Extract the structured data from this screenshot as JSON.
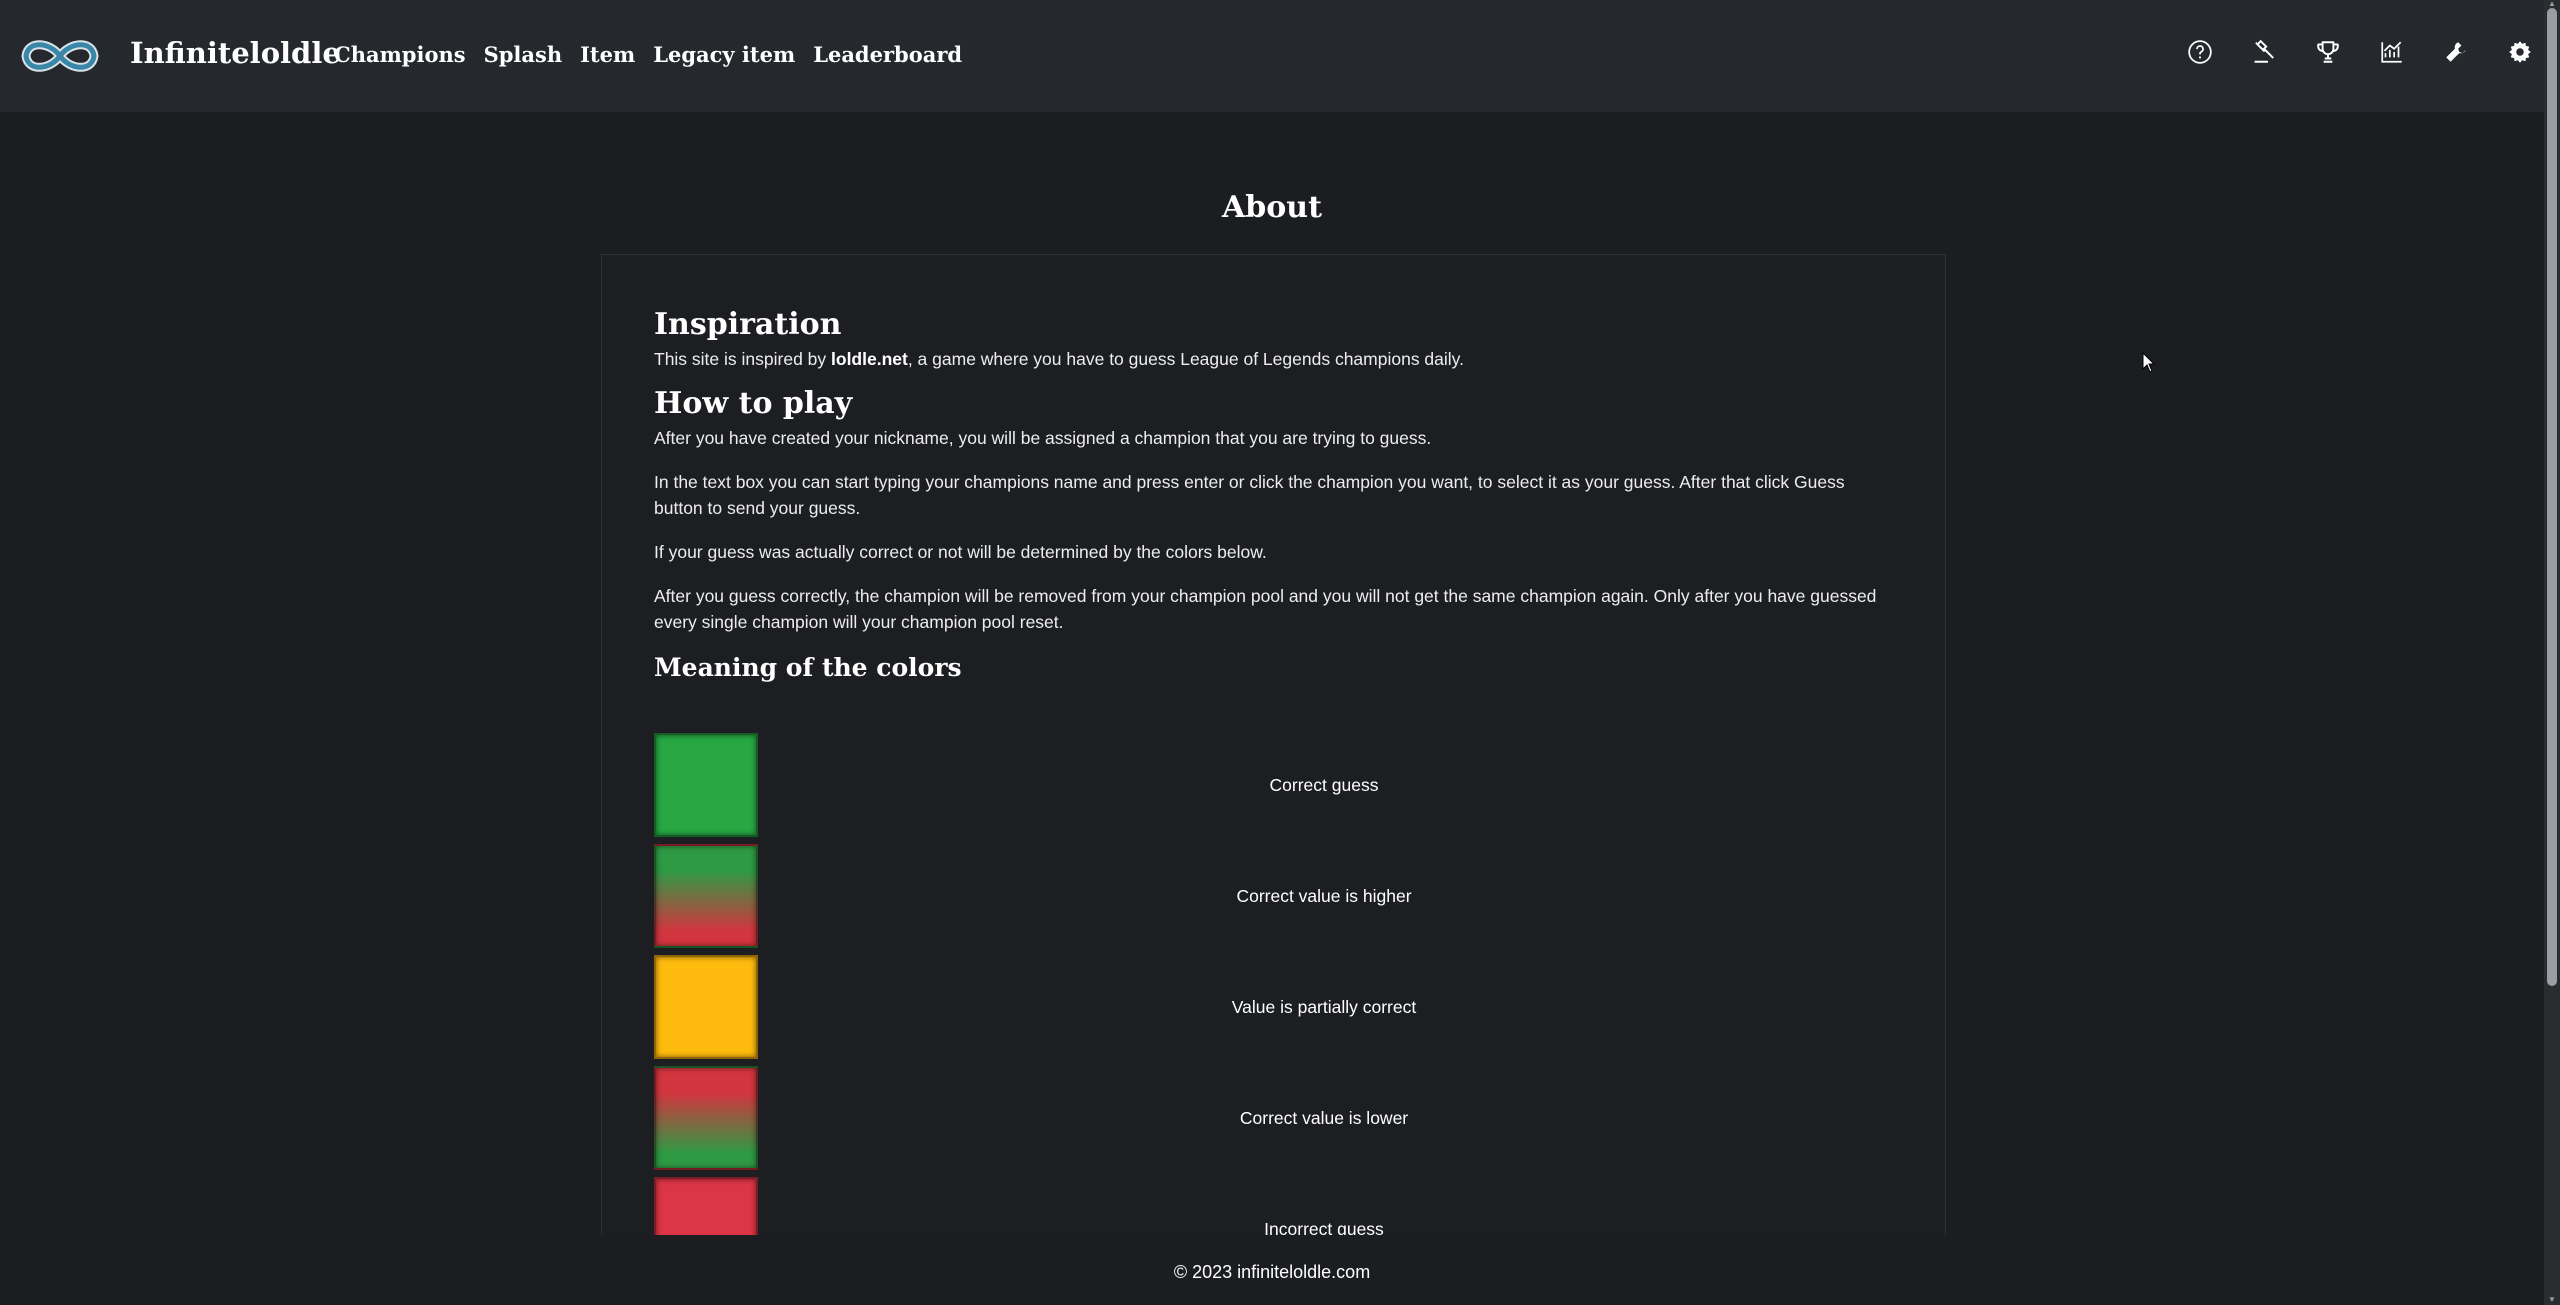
{
  "header": {
    "brand": "Infiniteloldle",
    "nav": [
      "Champions",
      "Splash",
      "Item",
      "Legacy item",
      "Leaderboard"
    ],
    "icons": [
      "help-icon",
      "gavel-icon",
      "trophy-icon",
      "stats-chart-icon",
      "wrench-icon",
      "gear-icon"
    ]
  },
  "main": {
    "title": "About",
    "inspiration": {
      "heading": "Inspiration",
      "text_before": "This site is inspired by ",
      "link": "loldle.net",
      "text_after": ", a game where you have to guess League of Legends champions daily."
    },
    "how_to_play": {
      "heading": "How to play",
      "paragraphs": [
        "After you have created your nickname, you will be assigned a champion that you are trying to guess.",
        "In the text box you can start typing your champions name and press enter or click the champion you want, to select it as your guess. After that click Guess button to send your guess.",
        "If your guess was actually correct or not will be determined by the colors below.",
        "After you guess correctly, the champion will be removed from your champion pool and you will not get the same champion again. Only after you have guessed every single champion will your champion pool reset."
      ]
    },
    "colors": {
      "heading": "Meaning of the colors",
      "items": [
        {
          "label": "Correct guess",
          "color": "#27a843"
        },
        {
          "label": "Correct value is higher",
          "color_top": "#2f9a44",
          "color_bottom": "#d2353f"
        },
        {
          "label": "Value is partially correct",
          "color": "#ffbb0d"
        },
        {
          "label": "Correct value is lower",
          "color_top": "#d2353f",
          "color_bottom": "#2f9a44"
        },
        {
          "label": "Incorrect guess",
          "color": "#dc3545"
        }
      ]
    }
  },
  "footer": {
    "text": "© 2023 infiniteloldle.com"
  }
}
